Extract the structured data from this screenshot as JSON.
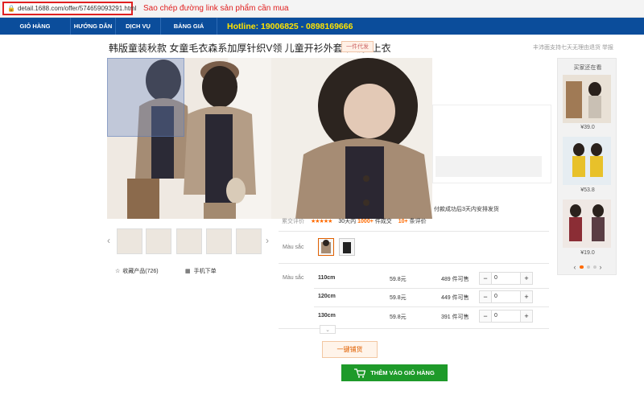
{
  "browser": {
    "url": "detail.1688.com/offer/574659093291.html"
  },
  "annotation": {
    "copy_link_note": "Sao chép đường link sản phẩm cần mua"
  },
  "nav": {
    "items": [
      "GIỎ HÀNG",
      "HƯỚNG DẪN",
      "DỊCH VỤ",
      "BẢNG GIÁ"
    ],
    "hotline": "Hotline: 19006825 - 0898169666"
  },
  "product": {
    "title": "韩版童装秋款 女童毛衣森系加厚针织V领 儿童开衫外套单排扣上衣",
    "tag": "一件代发",
    "top_right": "丰沛面支持七天无理由退货  举报",
    "favorites": "收藏产品(726)",
    "mobile_order": "手机下单",
    "price_panel_text": "付款成功后3天内安排发货"
  },
  "stats": {
    "label": "累交评价",
    "stars": "★★★★★",
    "days": "30天内",
    "sold": "1000+",
    "sold_unit": "件成交",
    "reviews": "10+",
    "reviews_unit": "条评价"
  },
  "color": {
    "label": "Màu sắc"
  },
  "sizes": {
    "label": "Màu sắc",
    "rows": [
      {
        "size": "110cm",
        "price": "59.8元",
        "stock": "489 件可售",
        "qty": "0"
      },
      {
        "size": "120cm",
        "price": "59.8元",
        "stock": "449 件可售",
        "qty": "0"
      },
      {
        "size": "130cm",
        "price": "59.8元",
        "stock": "391 件可售",
        "qty": "0"
      }
    ]
  },
  "buttons": {
    "one_key": "一键铺货",
    "add_to_cart": "THÊM VÀO GIỎ HÀNG",
    "more": "⌄"
  },
  "sidebar": {
    "title": "买家还在看",
    "items": [
      {
        "price": "¥39.0"
      },
      {
        "price": "¥53.8"
      },
      {
        "price": "¥19.0"
      }
    ]
  },
  "colors": {
    "nav_bg": "#0b4d9b",
    "hotline": "#ffe400",
    "accent": "#ff6a00",
    "cart_green": "#1e9a2a",
    "highlight_red": "#e02020"
  }
}
